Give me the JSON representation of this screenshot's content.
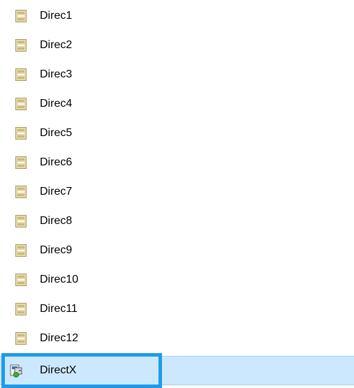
{
  "list": {
    "items": [
      {
        "label": "Direc1",
        "icon": "registry-file-icon"
      },
      {
        "label": "Direc2",
        "icon": "registry-file-icon"
      },
      {
        "label": "Direc3",
        "icon": "registry-file-icon"
      },
      {
        "label": "Direc4",
        "icon": "registry-file-icon"
      },
      {
        "label": "Direc5",
        "icon": "registry-file-icon"
      },
      {
        "label": "Direc6",
        "icon": "registry-file-icon"
      },
      {
        "label": "Direc7",
        "icon": "registry-file-icon"
      },
      {
        "label": "Direc8",
        "icon": "registry-file-icon"
      },
      {
        "label": "Direc9",
        "icon": "registry-file-icon"
      },
      {
        "label": "Direc10",
        "icon": "registry-file-icon"
      },
      {
        "label": "Direc11",
        "icon": "registry-file-icon"
      },
      {
        "label": "Direc12",
        "icon": "registry-file-icon"
      }
    ],
    "selected_item": {
      "label": "DirectX",
      "icon": "directx-installer-icon"
    }
  },
  "colors": {
    "selection_background": "#cce8ff",
    "focus_outline": "#1e9be8"
  }
}
